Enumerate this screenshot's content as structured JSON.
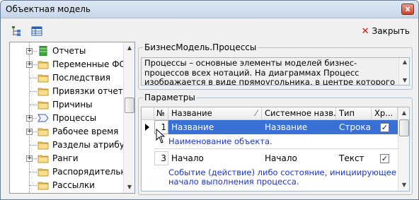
{
  "window": {
    "title": "Объектная модель",
    "close_symbol": "x"
  },
  "toolbar": {
    "close_label": "Закрыть"
  },
  "tree": {
    "items": [
      {
        "label": "Отчеты",
        "icon": "table-green-icon",
        "expandable": true
      },
      {
        "label": "Переменные ФСА",
        "icon": "folder-icon",
        "expandable": true
      },
      {
        "label": "Последствия",
        "icon": "folder-icon",
        "expandable": false
      },
      {
        "label": "Привязки отчетов",
        "icon": "folder-icon",
        "expandable": false
      },
      {
        "label": "Причины",
        "icon": "folder-icon",
        "expandable": false
      },
      {
        "label": "Процессы",
        "icon": "process-arrow-icon",
        "expandable": true
      },
      {
        "label": "Рабочее время",
        "icon": "folder-icon",
        "expandable": true
      },
      {
        "label": "Разделы атрибутов",
        "icon": "folder-icon",
        "expandable": false
      },
      {
        "label": "Ранги",
        "icon": "folder-icon",
        "expandable": true
      },
      {
        "label": "Распорядительны",
        "icon": "folder-icon",
        "expandable": false
      },
      {
        "label": "Рассылки",
        "icon": "folder-icon",
        "expandable": false
      }
    ]
  },
  "description": {
    "group_title": "БизнесМодель.Процессы",
    "text": "Процессы – основные элементы моделей бизнес-процессов всех нотаций. На диаграммах Процесс изображается в виде прямоугольника, в центре которого показано название Процесса."
  },
  "params": {
    "group_title": "Параметры",
    "headers": [
      "№",
      "Название",
      "Системное назв...",
      "Тип",
      "Хр..."
    ],
    "rows": [
      {
        "num": "1",
        "name": "Название",
        "sysname": "Название",
        "type": "Строка",
        "checked": "✓",
        "desc": "Наименование объекта."
      },
      {
        "num": "3",
        "name": "Начало",
        "sysname": "Начало",
        "type": "Текст",
        "checked": "✓",
        "desc": "Событие (действие) либо состояние, инициирующее начало выполнения процесса."
      }
    ]
  }
}
